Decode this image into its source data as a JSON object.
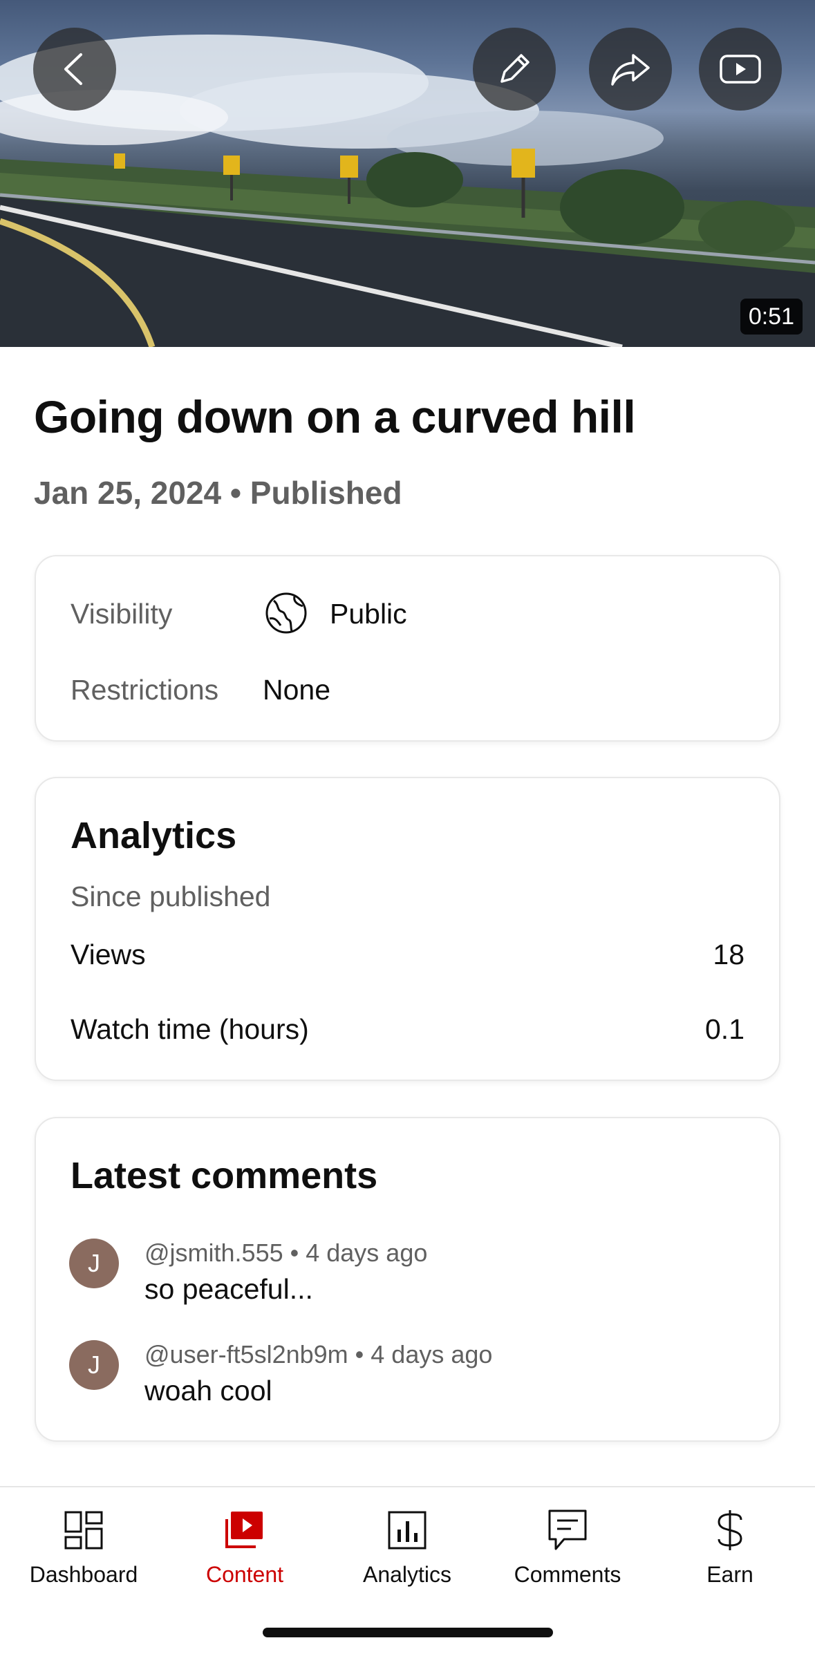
{
  "video": {
    "duration": "0:51",
    "buttons": {
      "back": "back",
      "edit": "edit",
      "share": "share",
      "watch": "watch on youtube"
    }
  },
  "title": "Going down on a curved hill",
  "subtitle": "Jan 25, 2024 • Published",
  "details": {
    "visibility_label": "Visibility",
    "visibility_value": "Public",
    "restrictions_label": "Restrictions",
    "restrictions_value": "None"
  },
  "analytics": {
    "heading": "Analytics",
    "since": "Since published",
    "stats": [
      {
        "label": "Views",
        "value": "18"
      },
      {
        "label": "Watch time (hours)",
        "value": "0.1"
      }
    ]
  },
  "comments": {
    "heading": "Latest comments",
    "items": [
      {
        "avatar": "J",
        "meta": "@jsmith.555 • 4 days ago",
        "text": "so peaceful..."
      },
      {
        "avatar": "J",
        "meta": "@user-ft5sl2nb9m • 4 days ago",
        "text": "woah cool"
      }
    ]
  },
  "nav": {
    "items": [
      {
        "label": "Dashboard",
        "icon": "dashboard-icon"
      },
      {
        "label": "Content",
        "icon": "content-icon",
        "active": true
      },
      {
        "label": "Analytics",
        "icon": "analytics-icon"
      },
      {
        "label": "Comments",
        "icon": "comments-icon"
      },
      {
        "label": "Earn",
        "icon": "dollar-icon"
      }
    ],
    "active_color": "#cc0000"
  }
}
